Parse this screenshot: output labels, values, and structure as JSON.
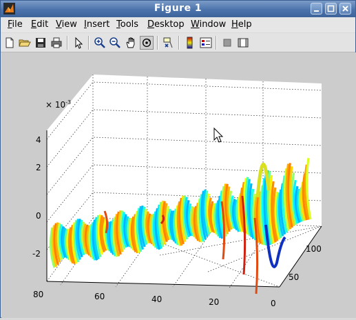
{
  "window": {
    "title": "Figure 1"
  },
  "menu": [
    {
      "key": "F",
      "rest": "ile"
    },
    {
      "key": "E",
      "rest": "dit"
    },
    {
      "key": "V",
      "rest": "iew"
    },
    {
      "key": "I",
      "rest": "nsert"
    },
    {
      "key": "T",
      "rest": "ools"
    },
    {
      "key": "D",
      "rest": "esktop"
    },
    {
      "key": "W",
      "rest": "indow"
    },
    {
      "key": "H",
      "rest": "elp"
    }
  ],
  "toolbar": [
    "new-file-icon",
    "open-folder-icon",
    "save-icon",
    "print-icon",
    "pointer-icon",
    "zoom-in-icon",
    "zoom-out-icon",
    "pan-hand-icon",
    "rotate-3d-icon",
    "data-cursor-icon",
    "colorbar-icon",
    "legend-icon",
    "hide-plot-tools-icon",
    "show-plot-tools-icon"
  ],
  "plot": {
    "exponent_label": "× 10",
    "exponent_power": "-3",
    "z_ticks": [
      "4",
      "2",
      "0",
      "-2"
    ],
    "x_ticks": [
      "80",
      "60",
      "40",
      "20",
      "0"
    ],
    "y_ticks": [
      "50",
      "100"
    ],
    "colors": {
      "background": "#cccccc",
      "axes": "#ffffff"
    }
  }
}
